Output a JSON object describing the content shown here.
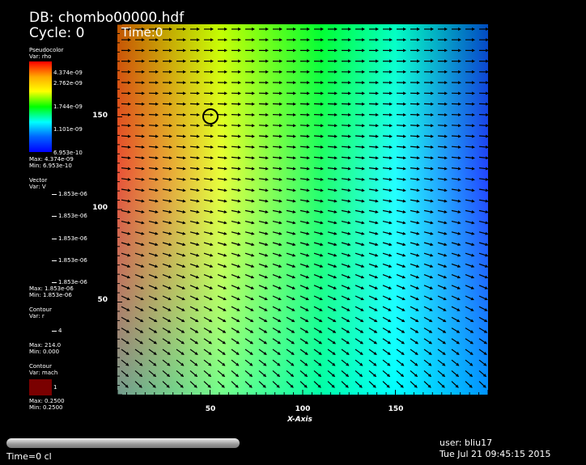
{
  "header": {
    "db": "DB: chombo00000.hdf",
    "cycle": "Cycle: 0",
    "time": "Time:0"
  },
  "legend": {
    "pseudocolor": {
      "title": "Pseudocolor",
      "var": "Var: rho",
      "ticks": [
        "4.374e-09",
        "2.762e-09",
        "1.744e-09",
        "1.101e-09",
        "6.953e-10"
      ],
      "max": "Max: 4.374e-09",
      "min": "Min: 6.953e-10"
    },
    "vector": {
      "title": "Vector",
      "var": "Var: V",
      "ticks": [
        "1.853e-06",
        "1.853e-06",
        "1.853e-06",
        "1.853e-06",
        "1.853e-06"
      ],
      "max": "Max: 1.853e-06",
      "min": "Min: 1.853e-06"
    },
    "contour_r": {
      "title": "Contour",
      "var": "Var: r",
      "tick": "4",
      "max": "Max: 214.0",
      "min": "Min: 0.000"
    },
    "contour_mach": {
      "title": "Contour",
      "var": "Var: mach",
      "tick": "1",
      "swatch_color": "#7a0000",
      "max": "Max: 0.2500",
      "min": "Min: 0.2500"
    }
  },
  "axes": {
    "xlabel": "X-Axis",
    "xticks": [
      "50",
      "100",
      "150"
    ],
    "yticks": [
      "150",
      "100",
      "50"
    ]
  },
  "colors": {
    "field_hot": "#ff2000",
    "field_mid": "#ffff00",
    "field_cool": "#00ffff",
    "field_cold": "#0000ff"
  },
  "status": {
    "time": "Time=0 cl",
    "user": "user: bliu17",
    "date": "Tue Jul 21 09:45:15 2015"
  }
}
